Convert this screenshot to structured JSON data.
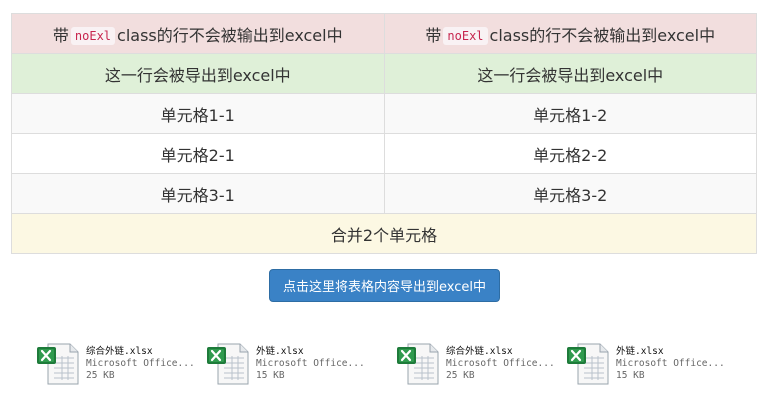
{
  "table": {
    "rows": [
      {
        "type": "danger",
        "cells": [
          {
            "pre": "带",
            "code": "noExl",
            "post": "class的行不会被输出到excel中"
          },
          {
            "pre": "带",
            "code": "noExl",
            "post": "class的行不会被输出到excel中"
          }
        ]
      },
      {
        "type": "success",
        "cells": [
          "这一行会被导出到excel中",
          "这一行会被导出到excel中"
        ]
      },
      {
        "type": "striped",
        "cells": [
          "单元格1-1",
          "单元格1-2"
        ]
      },
      {
        "type": "plain",
        "cells": [
          "单元格2-1",
          "单元格2-2"
        ]
      },
      {
        "type": "striped",
        "cells": [
          "单元格3-1",
          "单元格3-2"
        ]
      },
      {
        "type": "warning",
        "merged": "合并2个单元格"
      }
    ]
  },
  "export_button": {
    "label": "点击这里将表格内容导出到excel中"
  },
  "files": [
    {
      "name": "综合外链.xlsx",
      "type": "Microsoft Office...",
      "size": "25 KB",
      "icon": "excel-file-icon"
    },
    {
      "name": "外链.xlsx",
      "type": "Microsoft Office...",
      "size": "15 KB",
      "icon": "excel-file-icon"
    },
    {
      "name": "综合外链.xlsx",
      "type": "Microsoft Office...",
      "size": "25 KB",
      "icon": "excel-file-icon"
    },
    {
      "name": "外链.xlsx",
      "type": "Microsoft Office...",
      "size": "15 KB",
      "icon": "excel-file-icon"
    }
  ],
  "colors": {
    "danger_row": "#f2dede",
    "success_row": "#dff0d8",
    "warning_row": "#fcf8e3",
    "primary_button": "#3a82c6",
    "excel_green": "#1e7b3a"
  }
}
